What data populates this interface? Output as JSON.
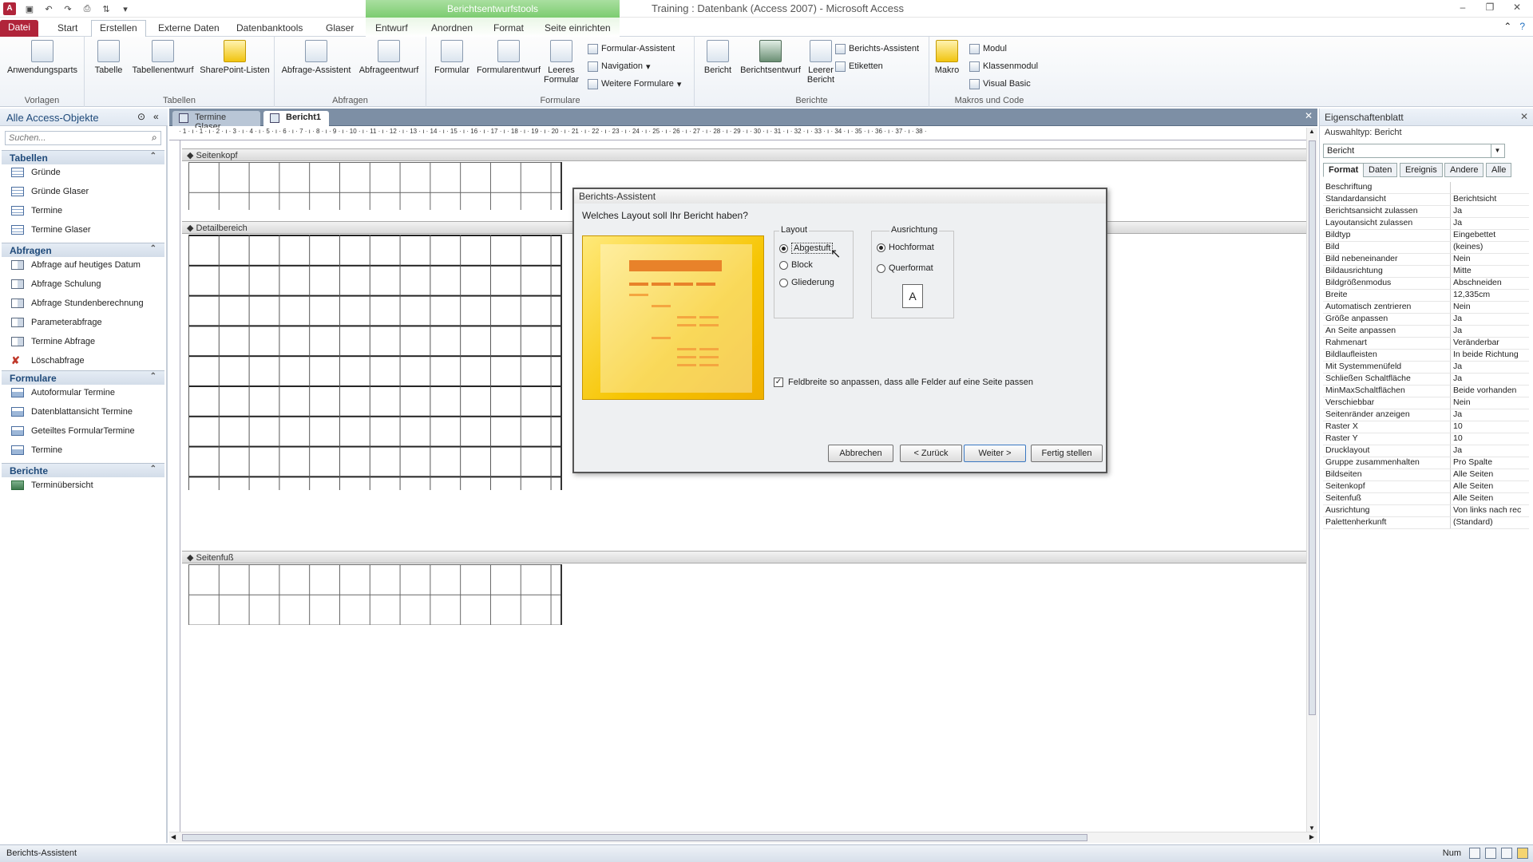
{
  "window": {
    "title": "Training : Datenbank (Access 2007) - Microsoft Access",
    "context_tools": "Berichtsentwurfstools"
  },
  "tabs": [
    "Datei",
    "Start",
    "Erstellen",
    "Externe Daten",
    "Datenbanktools",
    "Glaser",
    "Entwurf",
    "Anordnen",
    "Format",
    "Seite einrichten"
  ],
  "ribbon": {
    "groups": {
      "vorlagen": "Vorlagen",
      "tabellen": "Tabellen",
      "abfragen": "Abfragen",
      "formulare": "Formulare",
      "berichte": "Berichte",
      "makros": "Makros und Code"
    },
    "buttons": {
      "anwendungsparts": "Anwendungsparts",
      "tabelle": "Tabelle",
      "tabellenentwurf": "Tabellenentwurf",
      "sharepoint": "SharePoint-Listen",
      "abfrage_assistent": "Abfrage-Assistent",
      "abfrageentwurf": "Abfrageentwurf",
      "formular": "Formular",
      "formularentwurf": "Formularentwurf",
      "leeres_formular": "Leeres Formular",
      "formular_assistent": "Formular-Assistent",
      "navigation": "Navigation",
      "weitere_formulare": "Weitere Formulare",
      "bericht": "Bericht",
      "berichtsentwurf": "Berichtsentwurf",
      "leerer_bericht": "Leerer Bericht",
      "berichts_assistent": "Berichts-Assistent",
      "etiketten": "Etiketten",
      "makro": "Makro",
      "modul": "Modul",
      "klassenmodul": "Klassenmodul",
      "visual_basic": "Visual Basic"
    }
  },
  "nav": {
    "title": "Alle Access-Objekte",
    "search_placeholder": "Suchen...",
    "groups": [
      {
        "label": "Tabellen",
        "items": [
          "Gründe",
          "Gründe Glaser",
          "Termine",
          "Termine Glaser"
        ]
      },
      {
        "label": "Abfragen",
        "items": [
          "Abfrage auf heutiges Datum",
          "Abfrage Schulung",
          "Abfrage Stundenberechnung",
          "Parameterabfrage",
          "Termine Abfrage",
          "Löschabfrage"
        ]
      },
      {
        "label": "Formulare",
        "items": [
          "Autoformular Termine",
          "Datenblattansicht Termine",
          "Geteiltes FormularTermine",
          "Termine"
        ]
      },
      {
        "label": "Berichte",
        "items": [
          "Terminübersicht"
        ]
      }
    ]
  },
  "doc_tabs": [
    "Termine Glaser",
    "Bericht1"
  ],
  "sections": {
    "header": "Seitenkopf",
    "detail": "Detailbereich",
    "footer": "Seitenfuß"
  },
  "ruler_text": "· 1 · ı · 1 · ı · 2 · ı · 3 · ı · 4 · ı · 5 · ı · 6 · ı · 7 · ı · 8 · ı · 9 · ı · 10 · ı · 11 · ı · 12 · ı · 13 · ı · 14 · ı · 15 · ı · 16 · ı · 17 · ı · 18 · ı · 19 · ı · 20 · ı · 21 · ı · 22 · ı · 23 · ı · 24 · ı · 25 · ı · 26 · ı · 27 · ı · 28 · ı · 29 · ı · 30 · ı · 31 · ı · 32 · ı · 33 · ı · 34 · ı · 35 · ı · 36 · ı · 37 · ı · 38 ·",
  "props": {
    "title": "Eigenschaftenblatt",
    "selection_type": "Auswahltyp: Bericht",
    "selection": "Bericht",
    "tabs": [
      "Format",
      "Daten",
      "Ereignis",
      "Andere",
      "Alle"
    ],
    "rows": [
      [
        "Beschriftung",
        ""
      ],
      [
        "Standardansicht",
        "Berichtsicht"
      ],
      [
        "Berichtsansicht zulassen",
        "Ja"
      ],
      [
        "Layoutansicht zulassen",
        "Ja"
      ],
      [
        "Bildtyp",
        "Eingebettet"
      ],
      [
        "Bild",
        "(keines)"
      ],
      [
        "Bild nebeneinander",
        "Nein"
      ],
      [
        "Bildausrichtung",
        "Mitte"
      ],
      [
        "Bildgrößenmodus",
        "Abschneiden"
      ],
      [
        "Breite",
        "12,335cm"
      ],
      [
        "Automatisch zentrieren",
        "Nein"
      ],
      [
        "Größe anpassen",
        "Ja"
      ],
      [
        "An Seite anpassen",
        "Ja"
      ],
      [
        "Rahmenart",
        "Veränderbar"
      ],
      [
        "Bildlaufleisten",
        "In beide Richtung"
      ],
      [
        "Mit Systemmenüfeld",
        "Ja"
      ],
      [
        "Schließen Schaltfläche",
        "Ja"
      ],
      [
        "MinMaxSchaltflächen",
        "Beide vorhanden"
      ],
      [
        "Verschiebbar",
        "Nein"
      ],
      [
        "Seitenränder anzeigen",
        "Ja"
      ],
      [
        "Raster X",
        "10"
      ],
      [
        "Raster Y",
        "10"
      ],
      [
        "Drucklayout",
        "Ja"
      ],
      [
        "Gruppe zusammenhalten",
        "Pro Spalte"
      ],
      [
        "Bildseiten",
        "Alle Seiten"
      ],
      [
        "Seitenkopf",
        "Alle Seiten"
      ],
      [
        "Seitenfuß",
        "Alle Seiten"
      ],
      [
        "Ausrichtung",
        "Von links nach rec"
      ],
      [
        "Palettenherkunft",
        "(Standard)"
      ]
    ]
  },
  "dialog": {
    "title": "Berichts-Assistent",
    "question": "Welches Layout soll Ihr Bericht haben?",
    "layout_label": "Layout",
    "layout_options": [
      "Abgestuft",
      "Block",
      "Gliederung"
    ],
    "orient_label": "Ausrichtung",
    "orient_options": [
      "Hochformat",
      "Querformat"
    ],
    "orient_icon": "A",
    "fit_label": "Feldbreite so anpassen, dass alle Felder auf eine Seite passen",
    "buttons": {
      "cancel": "Abbrechen",
      "back": "< Zurück",
      "next": "Weiter >",
      "finish": "Fertig stellen"
    }
  },
  "status": {
    "left": "Berichts-Assistent",
    "num": "Num"
  },
  "colors": {
    "file_tab": "#b0243a",
    "context": "#7ccc70",
    "accent": "#1f4a7a"
  }
}
